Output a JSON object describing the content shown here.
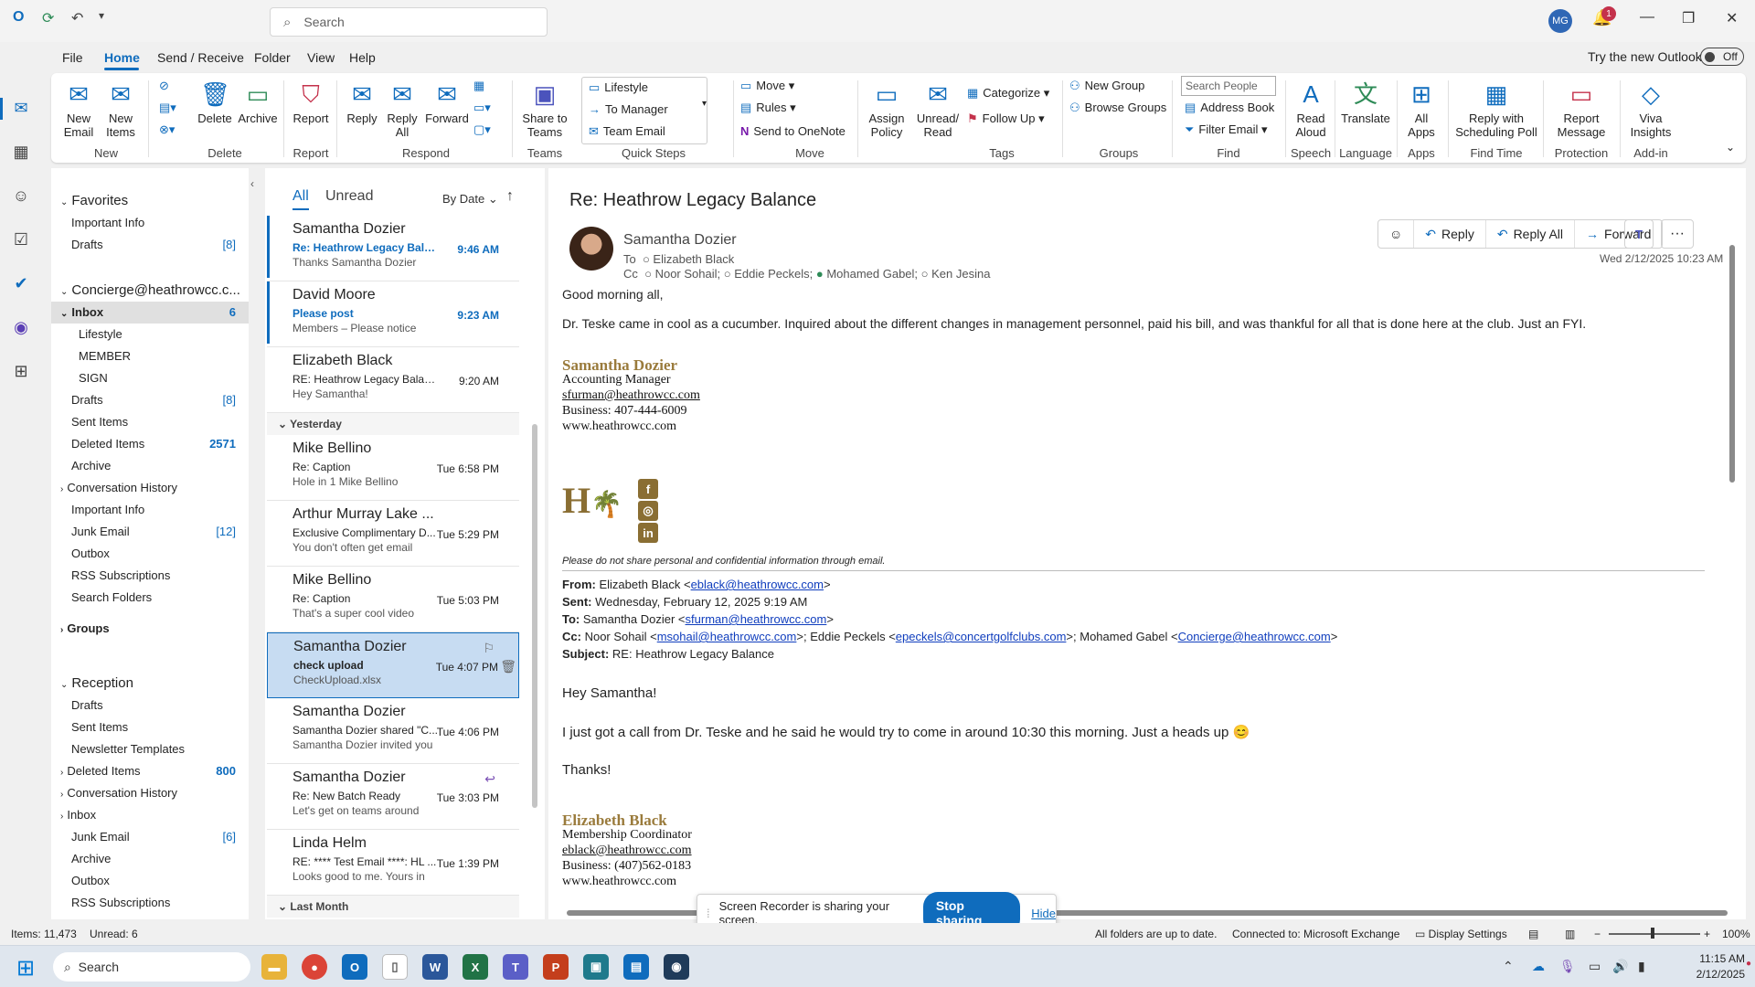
{
  "titlebar": {
    "search_placeholder": "Search",
    "avatar_initials": "MG",
    "notifications_count": "1"
  },
  "menu": [
    "File",
    "Home",
    "Send / Receive",
    "Folder",
    "View",
    "Help"
  ],
  "try_new_outlook": {
    "label": "Try the new Outlook",
    "toggle": "Off"
  },
  "ribbon": {
    "new_email": "New\nEmail",
    "new_items": "New\nItems",
    "delete": "Delete",
    "archive": "Archive",
    "report": "Report",
    "reply": "Reply",
    "reply_all": "Reply\nAll",
    "forward": "Forward",
    "share_to_teams": "Share to\nTeams",
    "quick_steps": [
      "Lifestyle",
      "To Manager",
      "Team Email"
    ],
    "move": "Move",
    "rules": "Rules",
    "send_to_onenote": "Send to OneNote",
    "assign_policy": "Assign\nPolicy",
    "unread_read": "Unread/\nRead",
    "categorize": "Categorize",
    "follow_up": "Follow Up",
    "new_group": "New Group",
    "browse_groups": "Browse Groups",
    "search_people_placeholder": "Search People",
    "address_book": "Address Book",
    "filter_email": "Filter Email",
    "read_aloud": "Read\nAloud",
    "translate": "Translate",
    "all_apps": "All\nApps",
    "reply_with_scheduling_poll": "Reply with\nScheduling Poll",
    "report_message": "Report\nMessage",
    "viva_insights": "Viva\nInsights",
    "groups_labels": [
      "New",
      "Delete",
      "Report",
      "Respond",
      "Teams",
      "Quick Steps",
      "Move",
      "Tags",
      "Groups",
      "Find",
      "Speech",
      "Language",
      "Apps",
      "Find Time",
      "Protection",
      "Add-in"
    ]
  },
  "folders": {
    "favorites_header": "Favorites",
    "favorites": [
      {
        "name": "Important Info",
        "count": ""
      },
      {
        "name": "Drafts",
        "count": "[8]"
      }
    ],
    "account_header": "Concierge@heathrowcc.c...",
    "inbox": {
      "name": "Inbox",
      "count": "6"
    },
    "inbox_children": [
      "Lifestyle",
      "MEMBER",
      "SIGN"
    ],
    "account_folders": [
      {
        "name": "Drafts",
        "count": "[8]"
      },
      {
        "name": "Sent Items",
        "count": ""
      },
      {
        "name": "Deleted Items",
        "count": "2571"
      },
      {
        "name": "Archive",
        "count": ""
      },
      {
        "name": "Conversation History",
        "count": ""
      },
      {
        "name": "Important Info",
        "count": ""
      },
      {
        "name": "Junk Email",
        "count": "[12]"
      },
      {
        "name": "Outbox",
        "count": ""
      },
      {
        "name": "RSS Subscriptions",
        "count": ""
      },
      {
        "name": "Search Folders",
        "count": ""
      }
    ],
    "groups_header": "Groups",
    "reception_header": "Reception",
    "reception_folders": [
      {
        "name": "Drafts",
        "count": ""
      },
      {
        "name": "Sent Items",
        "count": ""
      },
      {
        "name": "Newsletter Templates",
        "count": ""
      },
      {
        "name": "Deleted Items",
        "count": "800"
      },
      {
        "name": "Conversation History",
        "count": ""
      },
      {
        "name": "Inbox",
        "count": ""
      },
      {
        "name": "Junk Email",
        "count": "[6]"
      },
      {
        "name": "Archive",
        "count": ""
      },
      {
        "name": "Outbox",
        "count": ""
      },
      {
        "name": "RSS Subscriptions",
        "count": ""
      }
    ]
  },
  "message_list": {
    "filter_all": "All",
    "filter_unread": "Unread",
    "sort": "By Date",
    "group_yesterday": "Yesterday",
    "group_last_month": "Last Month",
    "messages": [
      {
        "from": "Samantha Dozier",
        "subject": "Re: Heathrow Legacy Bala...",
        "time": "9:46 AM",
        "preview": "Thanks  Samantha Dozier"
      },
      {
        "from": "David Moore",
        "subject": "Please post",
        "time": "9:23 AM",
        "preview": "Members –  Please notice"
      },
      {
        "from": "Elizabeth Black",
        "subject": "RE: Heathrow Legacy Balance",
        "time": "9:20 AM",
        "preview": "Hey Samantha!"
      },
      {
        "from": "Mike Bellino",
        "subject": "Re: Caption",
        "time": "Tue 6:58 PM",
        "preview": "Hole in 1  Mike Bellino"
      },
      {
        "from": "Arthur Murray Lake ...",
        "subject": "Exclusive Complimentary D...",
        "time": "Tue 5:29 PM",
        "preview": "You don't often get email"
      },
      {
        "from": "Mike Bellino",
        "subject": "Re: Caption",
        "time": "Tue 5:03 PM",
        "preview": "That's a super cool video"
      },
      {
        "from": "Samantha Dozier",
        "subject": "check upload",
        "time": "Tue 4:07 PM",
        "preview": "CheckUpload.xlsx"
      },
      {
        "from": "Samantha Dozier",
        "subject": "Samantha Dozier shared \"C...",
        "time": "Tue 4:06 PM",
        "preview": "Samantha Dozier invited you"
      },
      {
        "from": "Samantha Dozier",
        "subject": "Re: New Batch Ready",
        "time": "Tue 3:03 PM",
        "preview": "Let's get on teams around"
      },
      {
        "from": "Linda Helm",
        "subject": "RE: **** Test Email ****: HL ...",
        "time": "Tue 1:39 PM",
        "preview": "Looks good to me.  Yours in"
      }
    ]
  },
  "reading": {
    "subject": "Re: Heathrow Legacy Balance",
    "sender": "Samantha Dozier",
    "to_label": "To",
    "to": "Elizabeth Black",
    "cc_label": "Cc",
    "cc": [
      "Noor Sohail;",
      "Eddie Peckels;",
      "Mohamed Gabel;",
      "Ken Jesina"
    ],
    "actions": {
      "reply": "Reply",
      "reply_all": "Reply All",
      "forward": "Forward"
    },
    "date": "Wed 2/12/2025 10:23 AM",
    "greeting": "Good morning all,",
    "body": "Dr. Teske came in cool as a cucumber. Inquired about the different changes in management personnel, paid his bill, and was thankful for all that is done here at the club. Just an FYI.",
    "sig1": {
      "name": "Samantha Dozier",
      "title": "Accounting Manager",
      "email": "sfurman@heathrowcc.com",
      "phone": "Business: 407-444-6009",
      "web": "www.heathrowcc.com"
    },
    "disclaimer": "Please do not share personal and confidential information through email.",
    "quoted": {
      "from_label": "From:",
      "from": "Elizabeth Black <",
      "from_email": "eblack@heathrowcc.com",
      "sent_label": "Sent:",
      "sent": "Wednesday, February 12, 2025 9:19 AM",
      "to_label": "To:",
      "to": "Samantha Dozier <",
      "to_email": "sfurman@heathrowcc.com",
      "cc_label": "Cc:",
      "cc1": "Noor Sohail <",
      "cc1_email": "msohail@heathrowcc.com",
      "cc2": "Eddie Peckels <",
      "cc2_email": "epeckels@concertgolfclubs.com",
      "cc3": "Mohamed Gabel <",
      "cc3_email": "Concierge@heathrowcc.com",
      "subject_label": "Subject:",
      "subject": "RE: Heathrow Legacy Balance"
    },
    "q_greeting": "Hey Samantha!",
    "q_body": "I just got a call from Dr. Teske and he said he would try to come in around 10:30 this morning. Just a heads up 😊",
    "q_thanks": "Thanks!",
    "sig2": {
      "name": "Elizabeth Black",
      "title": "Membership Coordinator",
      "email": "eblack@heathrowcc.com",
      "phone": "Business: (407)562-0183",
      "web": "www.heathrowcc.com"
    }
  },
  "sharing": {
    "text": "Screen Recorder is sharing your screen.",
    "stop": "Stop sharing",
    "hide": "Hide"
  },
  "status": {
    "items": "Items: 11,473",
    "unread": "Unread: 6",
    "sync": "All folders are up to date.",
    "connection": "Connected to: Microsoft Exchange",
    "display_settings": "Display Settings",
    "zoom": "100%"
  },
  "taskbar": {
    "search": "Search",
    "time": "11:15 AM",
    "date": "2/12/2025"
  }
}
